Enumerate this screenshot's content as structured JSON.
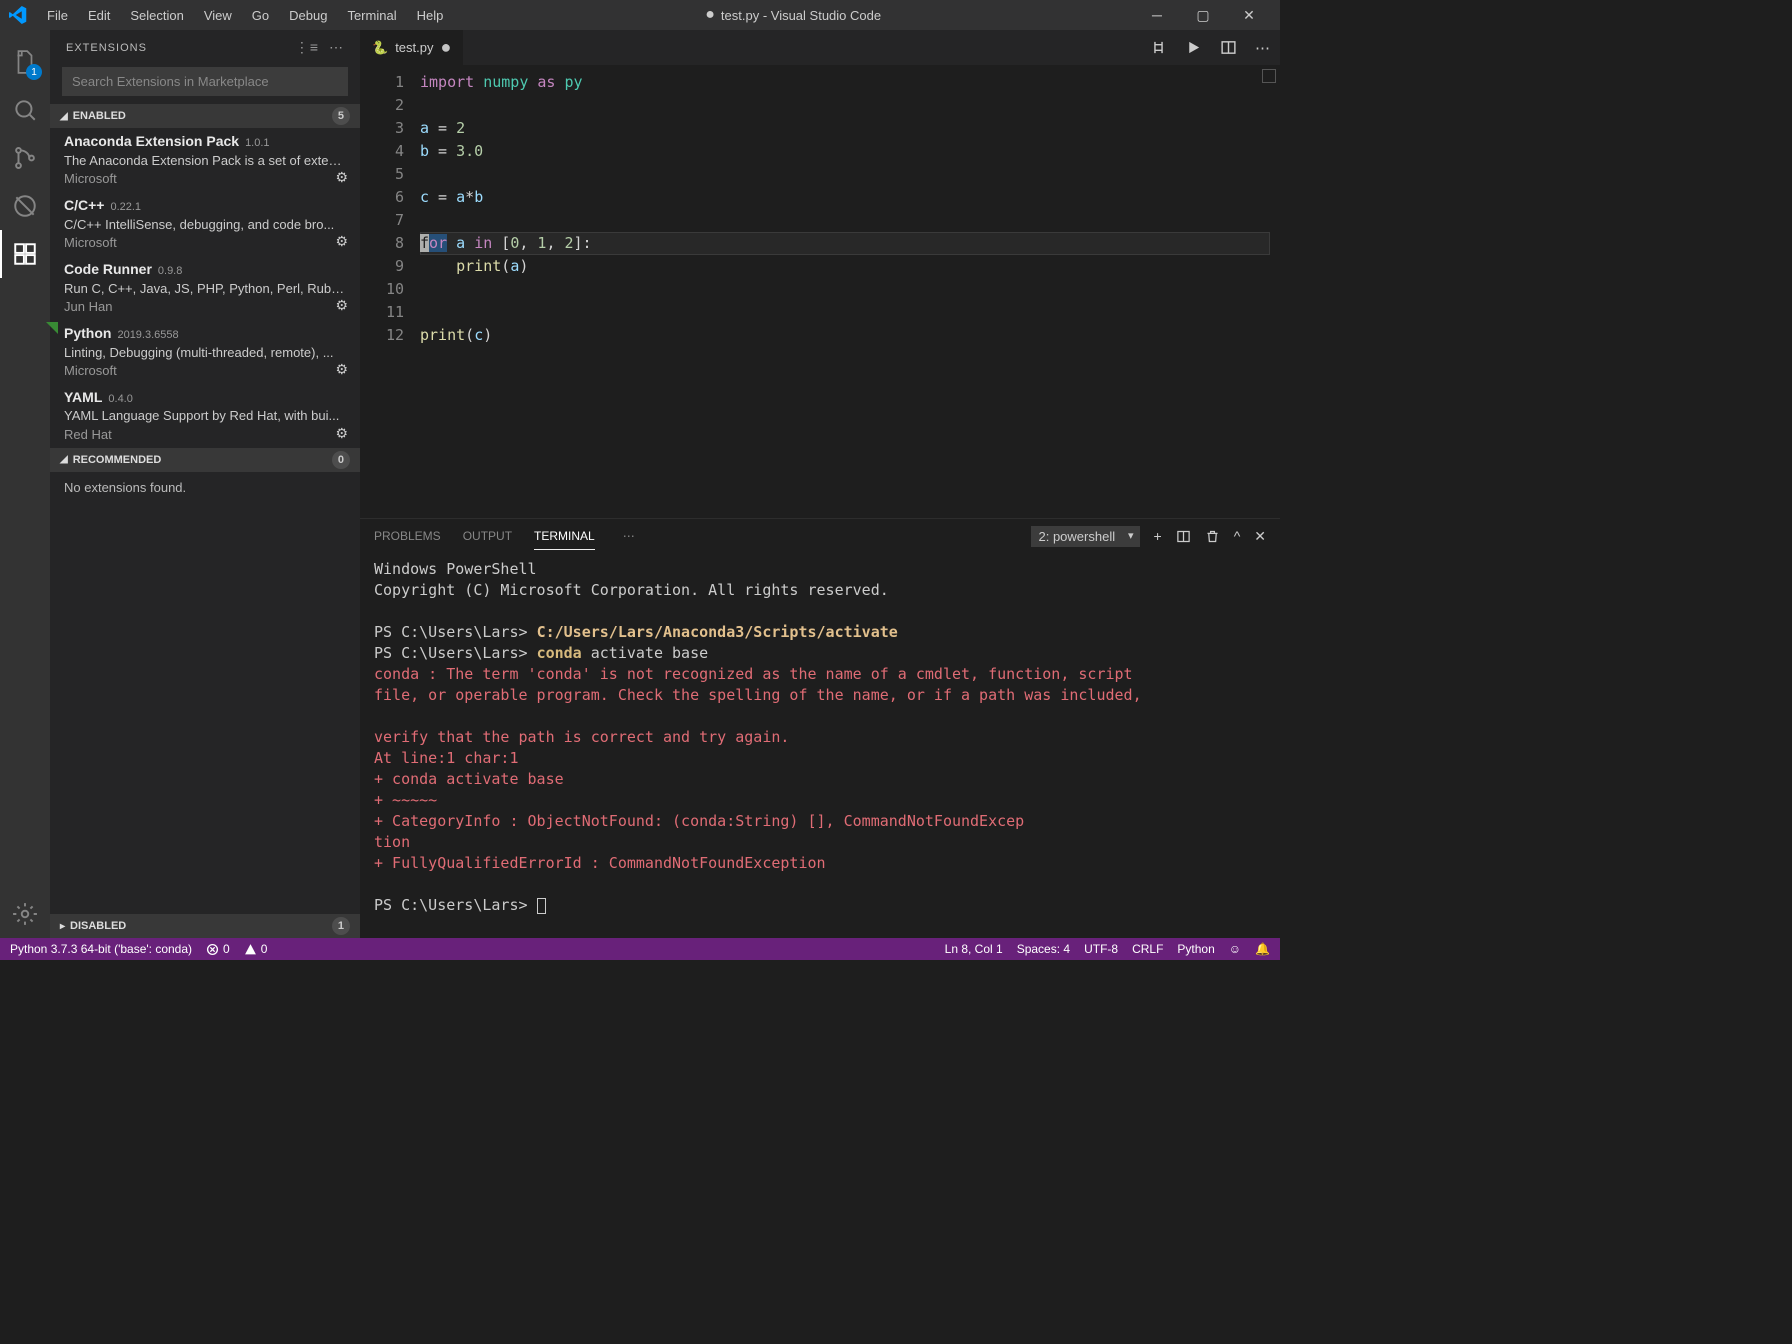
{
  "menu": [
    "File",
    "Edit",
    "Selection",
    "View",
    "Go",
    "Debug",
    "Terminal",
    "Help"
  ],
  "window_title": "test.py - Visual Studio Code",
  "activity_badge": "1",
  "sidebar": {
    "title": "EXTENSIONS",
    "search_placeholder": "Search Extensions in Marketplace",
    "enabled": {
      "label": "ENABLED",
      "count": "5"
    },
    "recommended": {
      "label": "RECOMMENDED",
      "count": "0",
      "empty": "No extensions found."
    },
    "disabled": {
      "label": "DISABLED",
      "count": "1"
    },
    "items": [
      {
        "name": "Anaconda Extension Pack",
        "ver": "1.0.1",
        "desc": "The Anaconda Extension Pack is a set of exten...",
        "pub": "Microsoft",
        "star": false
      },
      {
        "name": "C/C++",
        "ver": "0.22.1",
        "desc": "C/C++ IntelliSense, debugging, and code bro...",
        "pub": "Microsoft",
        "star": false
      },
      {
        "name": "Code Runner",
        "ver": "0.9.8",
        "desc": "Run C, C++, Java, JS, PHP, Python, Perl, Ruby, ...",
        "pub": "Jun Han",
        "star": false
      },
      {
        "name": "Python",
        "ver": "2019.3.6558",
        "desc": "Linting, Debugging (multi-threaded, remote), ...",
        "pub": "Microsoft",
        "star": true
      },
      {
        "name": "YAML",
        "ver": "0.4.0",
        "desc": "YAML Language Support by Red Hat, with bui...",
        "pub": "Red Hat",
        "star": false
      }
    ]
  },
  "tab": {
    "name": "test.py"
  },
  "code_lines": [
    "import numpy as py",
    "",
    "a = 2",
    "b = 3.0",
    "",
    "c = a*b",
    "",
    "for a in [0, 1, 2]:",
    "    print(a)",
    "",
    "",
    "print(c)"
  ],
  "panel": {
    "tabs": [
      "PROBLEMS",
      "OUTPUT",
      "TERMINAL"
    ],
    "active": "TERMINAL",
    "select": "2: powershell"
  },
  "terminal_lines": [
    {
      "t": "Windows PowerShell"
    },
    {
      "t": "Copyright (C) Microsoft Corporation. All rights reserved."
    },
    {
      "t": ""
    },
    {
      "prompt": "PS C:\\Users\\Lars> ",
      "cmd": "C:/Users/Lars/Anaconda3/Scripts/activate",
      "cls": "term-cmd"
    },
    {
      "prompt": "PS C:\\Users\\Lars> ",
      "cmd": "conda",
      "rest": " activate base",
      "cls": "term-yellow"
    },
    {
      "err": "conda : The term 'conda' is not recognized as the name of a cmdlet, function, script"
    },
    {
      "err": "file, or operable program. Check the spelling of the name, or if a path was included,"
    },
    {
      "err": ""
    },
    {
      "err": "verify that the path is correct and try again."
    },
    {
      "err": "At line:1 char:1"
    },
    {
      "err": "+ conda activate base"
    },
    {
      "err": "+ ~~~~~"
    },
    {
      "err": "    + CategoryInfo          : ObjectNotFound: (conda:String) [], CommandNotFoundExcep"
    },
    {
      "err": "tion"
    },
    {
      "err": "    + FullyQualifiedErrorId : CommandNotFoundException"
    },
    {
      "t": ""
    },
    {
      "prompt": "PS C:\\Users\\Lars> ",
      "cursor": true
    }
  ],
  "status": {
    "python": "Python 3.7.3 64-bit ('base': conda)",
    "errors": "0",
    "warnings": "0",
    "ln": "Ln 8, Col 1",
    "spaces": "Spaces: 4",
    "enc": "UTF-8",
    "eol": "CRLF",
    "lang": "Python"
  }
}
